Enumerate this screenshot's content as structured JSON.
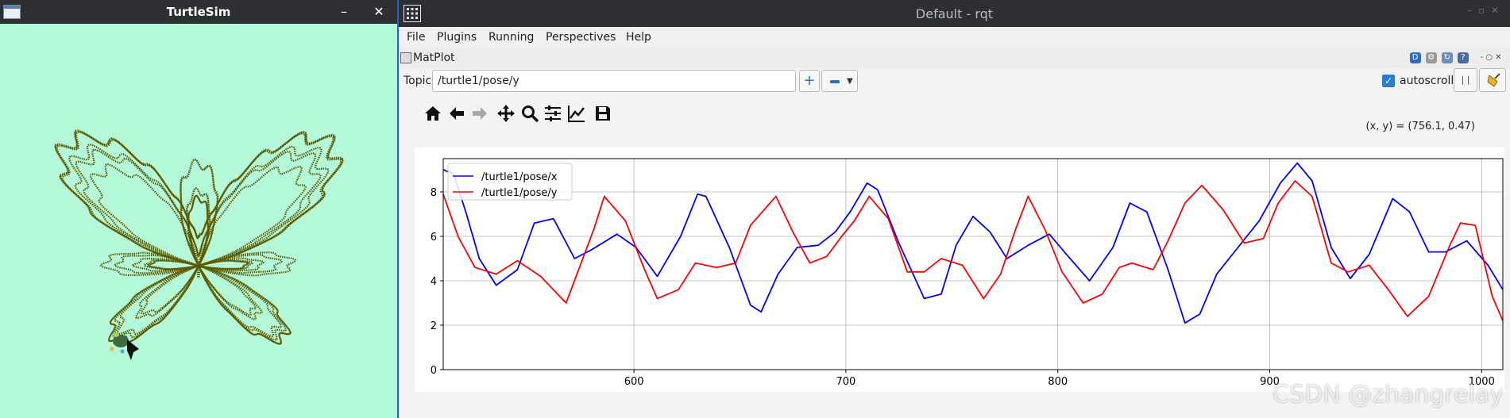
{
  "turtlesim": {
    "title": "TurtleSim",
    "minimize": "–",
    "close": "✕",
    "background": "#b4f8da",
    "pen_color": "#5e5a00"
  },
  "rqt": {
    "title": "Default - rqt",
    "menus": [
      "File",
      "Plugins",
      "Running",
      "Perspectives",
      "Help"
    ],
    "plugin_title": "MatPlot",
    "plugin_right_ctrls": "- ○ ✕",
    "topic_label": "Topic",
    "topic_value": "/turtle1/pose/y",
    "add_label": "+",
    "autoscroll_label": "autoscroll",
    "autoscroll_checked": true,
    "pause_label": "| |",
    "coords_readout": "(x, y) = (756.1, 0.47)",
    "toolbar_icons": [
      "home-icon",
      "back-arrow-icon",
      "forward-arrow-icon",
      "pan-icon",
      "zoom-icon",
      "subplots-config-icon",
      "edit-axis-icon",
      "save-icon"
    ]
  },
  "chart_data": {
    "type": "line",
    "xlim": [
      510,
      1010
    ],
    "ylim": [
      0,
      9.5
    ],
    "xticks": [
      600,
      700,
      800,
      900,
      1000
    ],
    "yticks": [
      0,
      2,
      4,
      6,
      8
    ],
    "grid": true,
    "legend_placement": "top-left",
    "series": [
      {
        "name": "/turtle1/pose/x",
        "color": "#0000ff",
        "x": [
          510,
          515,
          521,
          527,
          535,
          545,
          553,
          562,
          572,
          580,
          592,
          601,
          611,
          622,
          630,
          634,
          645,
          655,
          660,
          668,
          677,
          687,
          695,
          702,
          710,
          715,
          725,
          737,
          745,
          752,
          760,
          768,
          776,
          786,
          796,
          804,
          815,
          826,
          834,
          842,
          852,
          860,
          867,
          875,
          885,
          895,
          905,
          913,
          920,
          929,
          938,
          947,
          958,
          966,
          975,
          983,
          993,
          1003,
          1010
        ],
        "y": [
          9.0,
          8.8,
          7.0,
          5.0,
          3.8,
          4.5,
          6.6,
          6.8,
          5.0,
          5.4,
          6.1,
          5.5,
          4.2,
          6.0,
          7.9,
          7.8,
          5.5,
          2.9,
          2.6,
          4.3,
          5.5,
          5.6,
          6.2,
          7.1,
          8.4,
          8.1,
          5.7,
          3.2,
          3.4,
          5.6,
          6.9,
          6.2,
          5.0,
          5.6,
          6.1,
          5.2,
          4.0,
          5.5,
          7.5,
          7.1,
          4.5,
          2.1,
          2.5,
          4.3,
          5.5,
          6.7,
          8.4,
          9.3,
          8.5,
          5.5,
          4.1,
          5.2,
          7.7,
          7.1,
          5.3,
          5.3,
          5.8,
          4.7,
          3.6
        ]
      },
      {
        "name": "/turtle1/pose/y",
        "color": "#ff0000",
        "x": [
          510,
          517,
          525,
          535,
          545,
          556,
          568,
          581,
          586,
          596,
          605,
          611,
          621,
          629,
          639,
          648,
          655,
          667,
          675,
          683,
          691,
          698,
          704,
          711,
          720,
          729,
          737,
          745,
          755,
          765,
          773,
          780,
          786,
          794,
          802,
          812,
          821,
          829,
          835,
          845,
          852,
          860,
          868,
          878,
          888,
          897,
          904,
          912,
          920,
          929,
          937,
          947,
          956,
          965,
          975,
          985,
          990,
          997,
          1005,
          1010
        ],
        "y": [
          7.9,
          6.0,
          4.6,
          4.3,
          4.9,
          4.2,
          3.0,
          6.3,
          7.8,
          6.7,
          4.5,
          3.2,
          3.6,
          4.8,
          4.6,
          4.8,
          6.5,
          7.8,
          6.2,
          4.8,
          5.1,
          6.0,
          6.7,
          7.8,
          6.8,
          4.4,
          4.4,
          5.0,
          4.7,
          3.2,
          4.3,
          6.3,
          7.8,
          6.3,
          4.4,
          3.0,
          3.4,
          4.6,
          4.8,
          4.5,
          5.8,
          7.5,
          8.3,
          7.2,
          5.7,
          5.9,
          7.5,
          8.5,
          7.8,
          4.8,
          4.4,
          4.7,
          3.6,
          2.4,
          3.3,
          5.6,
          6.6,
          6.5,
          3.3,
          2.2
        ]
      }
    ]
  },
  "watermark": "CSDN @zhangrelay"
}
